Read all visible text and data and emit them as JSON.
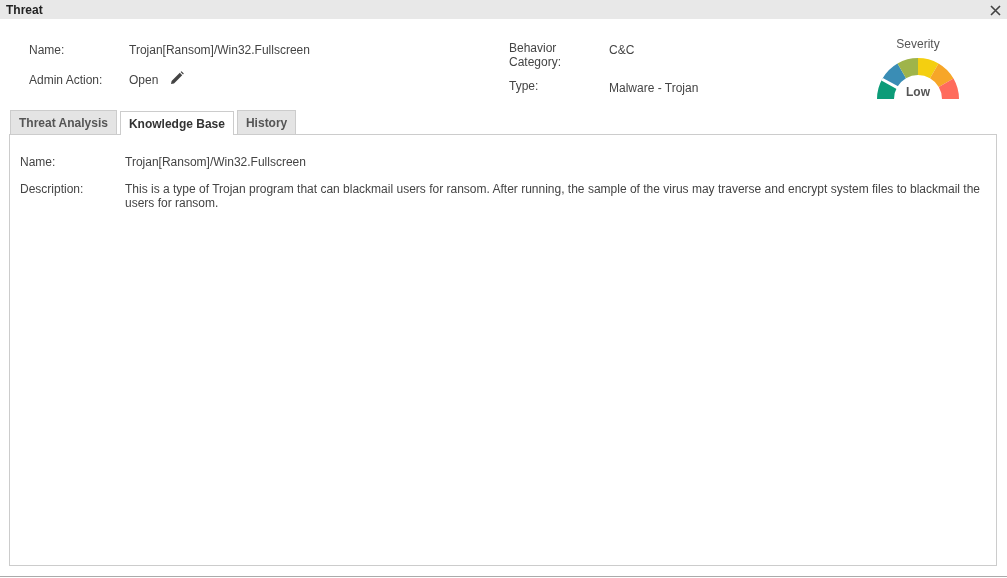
{
  "window": {
    "title": "Threat"
  },
  "summary": {
    "left": [
      {
        "label": "Name:",
        "value": "Trojan[Ransom]/Win32.Fullscreen",
        "editable": false
      },
      {
        "label": "Admin Action:",
        "value": "Open",
        "editable": true
      }
    ],
    "right": [
      {
        "label": "Behavior Category:",
        "value": "C&C"
      },
      {
        "label": "Type:",
        "value": "Malware - Trojan"
      }
    ]
  },
  "severity": {
    "title": "Severity",
    "reading": "Low"
  },
  "tabs": [
    {
      "label": "Threat Analysis",
      "selected": false
    },
    {
      "label": "Knowledge Base",
      "selected": true
    },
    {
      "label": "History",
      "selected": false
    }
  ],
  "knowledge_base": [
    {
      "label": "Name:",
      "value": "Trojan[Ransom]/Win32.Fullscreen"
    },
    {
      "label": "Description:",
      "value": "This is a type of Trojan program that can blackmail users for ransom. After running, the sample of the virus may traverse and encrypt system files to blackmail the users for ransom."
    }
  ]
}
